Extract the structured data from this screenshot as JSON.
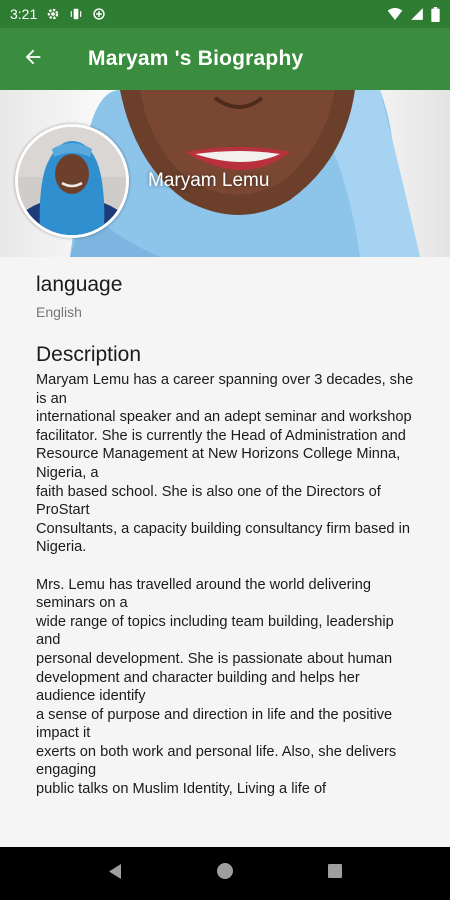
{
  "status_bar": {
    "time": "3:21",
    "icons_left": [
      "gear-icon",
      "vibrate-icon",
      "data-saver-icon"
    ],
    "icons_right": [
      "wifi-icon",
      "signal-icon",
      "battery-icon"
    ]
  },
  "app_bar": {
    "back_icon": "arrow-left-icon",
    "title": "Maryam 's Biography",
    "color": "#3a8d3e"
  },
  "header": {
    "name": "Maryam Lemu"
  },
  "profile": {
    "language_label": "language",
    "language_value": "English",
    "description_label": "Description",
    "description": "Maryam Lemu has a career spanning over 3 decades, she is an\ninternational speaker and an adept seminar and workshop\nfacilitator. She is currently the Head of Administration and\nResource Management at New Horizons College Minna, Nigeria, a\nfaith based school. She is also one of the Directors of ProStart\nConsultants, a capacity building consultancy firm based in Nigeria.\n\nMrs. Lemu has travelled around the world delivering seminars on a\nwide range of topics including team building, leadership and\npersonal development. She is passionate about human\ndevelopment and character building and helps her audience identify\na sense of purpose and direction in life and the positive impact it\nexerts on both work and personal life. Also, she delivers engaging\npublic talks on Muslim Identity, Living a life of"
  },
  "nav_bar": {
    "buttons": [
      "back-triangle-icon",
      "home-circle-icon",
      "recents-square-icon"
    ]
  }
}
